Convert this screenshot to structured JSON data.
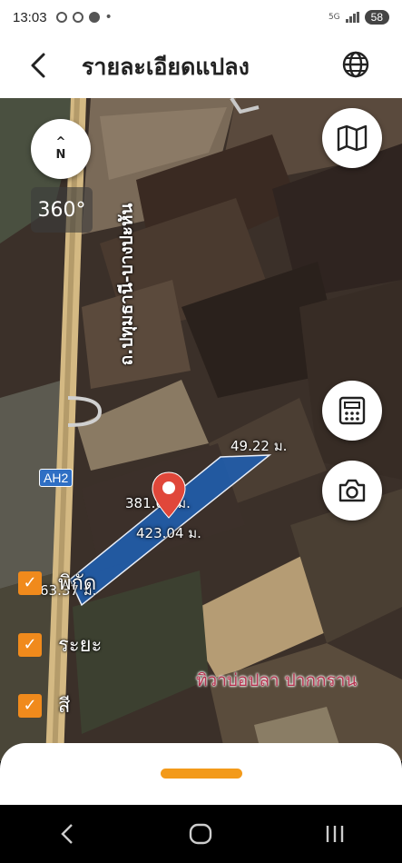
{
  "status_bar": {
    "time": "13:03",
    "network": "5G",
    "battery": "58"
  },
  "header": {
    "title": "รายละเอียดแปลง"
  },
  "map": {
    "compass_letter": "N",
    "heading": "360°",
    "road_label": "ถ.ปทุมธานี-บางปะหัน",
    "highway_shield": "AH2",
    "measurements": {
      "top_right": "49.22 ม.",
      "long_top": "381.66 ม.",
      "long_bottom": "423.04 ม.",
      "left": "63.37 ม."
    },
    "place_label": "ทิวาบ่อปลา ปากกราน"
  },
  "layers": [
    {
      "label": "พิกัด",
      "checked": true
    },
    {
      "label": "ระยะ",
      "checked": true
    },
    {
      "label": "สี",
      "checked": true
    }
  ],
  "colors": {
    "accent": "#f39a1a",
    "plot_fill": "#1f5fb0",
    "place_label": "#b5334f"
  }
}
